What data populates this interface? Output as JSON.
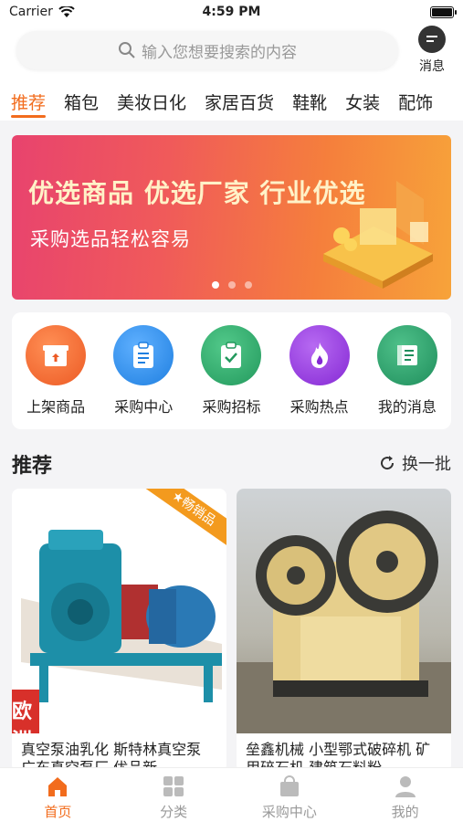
{
  "status_bar": {
    "carrier": "Carrier",
    "time": "4:59 PM"
  },
  "search": {
    "placeholder": "输入您想要搜索的内容"
  },
  "message_button": {
    "label": "消息"
  },
  "category_tabs": [
    "推荐",
    "箱包",
    "美妆日化",
    "家居百货",
    "鞋靴",
    "女装",
    "配饰"
  ],
  "active_tab": "推荐",
  "banner": {
    "headline": "优选商品 优选厂家 行业优选",
    "subline": "采购选品轻松容易",
    "dots": 3,
    "active_dot": 0
  },
  "quick_actions": [
    {
      "label": "上架商品",
      "icon": "shelf-upload-icon",
      "color": "#f0662f"
    },
    {
      "label": "采购中心",
      "icon": "clipboard-list-icon",
      "color": "#2f8fe8"
    },
    {
      "label": "采购招标",
      "icon": "clipboard-check-icon",
      "color": "#2ea86b"
    },
    {
      "label": "采购热点",
      "icon": "flame-icon",
      "color": "#9b3fe0"
    },
    {
      "label": "我的消息",
      "icon": "book-icon",
      "color": "#2e9e6e"
    }
  ],
  "recommend": {
    "title": "推荐",
    "refresh_label": "换一批"
  },
  "products": [
    {
      "name": "真空泵油乳化 斯特林真空泵 广东真空泵厂 优品新",
      "badge": "★畅销品",
      "stamp": "欧洲"
    },
    {
      "name": "垒鑫机械 小型鄂式破碎机 矿用碎石机 建筑石料粉"
    }
  ],
  "tab_bar": {
    "items": [
      {
        "label": "首页",
        "icon": "home-icon",
        "active": true
      },
      {
        "label": "分类",
        "icon": "grid-icon",
        "active": false
      },
      {
        "label": "采购中心",
        "icon": "shopping-bag-icon",
        "active": false
      },
      {
        "label": "我的",
        "icon": "user-icon",
        "active": false
      }
    ]
  },
  "colors": {
    "accent": "#f26c1d",
    "inactive": "#999999"
  }
}
